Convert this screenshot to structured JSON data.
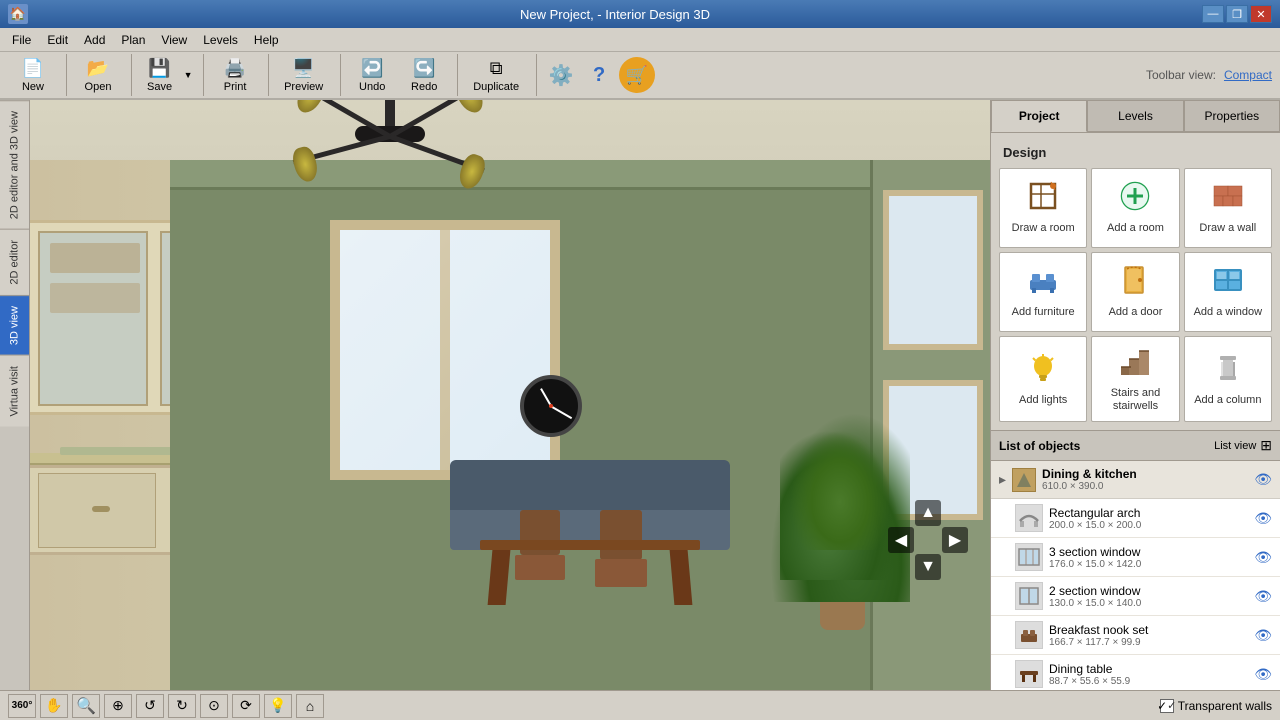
{
  "window": {
    "title": "New Project, - Interior Design 3D",
    "icon": "🏠"
  },
  "titlebar": {
    "minimize": "—",
    "restore": "❐",
    "close": "✕"
  },
  "menubar": {
    "items": [
      "File",
      "Edit",
      "Add",
      "Plan",
      "View",
      "Levels",
      "Help"
    ]
  },
  "toolbar": {
    "new_label": "New",
    "open_label": "Open",
    "save_label": "Save",
    "print_label": "Print",
    "preview_label": "Preview",
    "undo_label": "Undo",
    "redo_label": "Redo",
    "duplicate_label": "Duplicate",
    "settings_label": "⚙",
    "help_label": "?",
    "shop_label": "🛒",
    "toolbar_view_label": "Toolbar view:",
    "compact_label": "Compact"
  },
  "side_tabs": [
    {
      "id": "2d-3d-view",
      "label": "2D editor and 3D view"
    },
    {
      "id": "2d-editor",
      "label": "2D editor"
    },
    {
      "id": "3d-view",
      "label": "3D view",
      "active": true
    },
    {
      "id": "virtual-visit",
      "label": "Virtua visit"
    }
  ],
  "viewport": {
    "transparent_walls_label": "Transparent walls",
    "transparent_walls_checked": true
  },
  "bottom_tools": [
    {
      "id": "360",
      "icon": "360°"
    },
    {
      "id": "pan",
      "icon": "✋"
    },
    {
      "id": "zoom-out",
      "icon": "🔍−"
    },
    {
      "id": "zoom-in",
      "icon": "🔍+"
    },
    {
      "id": "rotate-ccw",
      "icon": "↺"
    },
    {
      "id": "rotate-cw",
      "icon": "↻"
    },
    {
      "id": "orbit",
      "icon": "⊙"
    },
    {
      "id": "spin",
      "icon": "⟳"
    },
    {
      "id": "light",
      "icon": "💡"
    },
    {
      "id": "home",
      "icon": "⌂"
    }
  ],
  "panel": {
    "tabs": [
      {
        "id": "project",
        "label": "Project",
        "active": true
      },
      {
        "id": "levels",
        "label": "Levels"
      },
      {
        "id": "properties",
        "label": "Properties"
      }
    ],
    "design_label": "Design",
    "design_buttons": [
      {
        "id": "draw-room",
        "icon": "✏️",
        "label": "Draw a room"
      },
      {
        "id": "add-room",
        "icon": "➕",
        "label": "Add a room"
      },
      {
        "id": "draw-wall",
        "icon": "🧱",
        "label": "Draw a wall"
      },
      {
        "id": "add-furniture",
        "icon": "🪑",
        "label": "Add furniture"
      },
      {
        "id": "add-door",
        "icon": "🚪",
        "label": "Add a door"
      },
      {
        "id": "add-window",
        "icon": "🪟",
        "label": "Add a window"
      },
      {
        "id": "add-lights",
        "icon": "💡",
        "label": "Add lights"
      },
      {
        "id": "stairs",
        "icon": "🪜",
        "label": "Stairs and stairwells"
      },
      {
        "id": "add-column",
        "icon": "🏛️",
        "label": "Add a column"
      }
    ],
    "objects_label": "List of objects",
    "list_view_label": "List view",
    "objects": [
      {
        "id": "dining-kitchen",
        "type": "group",
        "name": "Dining & kitchen",
        "dims": "610.0 × 390.0",
        "icon": "◆"
      },
      {
        "id": "rectangular-arch",
        "type": "item",
        "name": "Rectangular arch",
        "dims": "200.0 × 15.0 × 200.0",
        "icon": "⬜"
      },
      {
        "id": "3-section-window",
        "type": "item",
        "name": "3 section window",
        "dims": "176.0 × 15.0 × 142.0",
        "icon": "⬜"
      },
      {
        "id": "2-section-window",
        "type": "item",
        "name": "2 section window",
        "dims": "130.0 × 15.0 × 140.0",
        "icon": "⬜"
      },
      {
        "id": "breakfast-nook-set",
        "type": "item",
        "name": "Breakfast nook set",
        "dims": "166.7 × 117.7 × 99.9",
        "icon": "🪑"
      },
      {
        "id": "dining-table",
        "type": "item",
        "name": "Dining table",
        "dims": "88.7 × 55.6 × 55.9",
        "icon": "🪑"
      }
    ]
  }
}
